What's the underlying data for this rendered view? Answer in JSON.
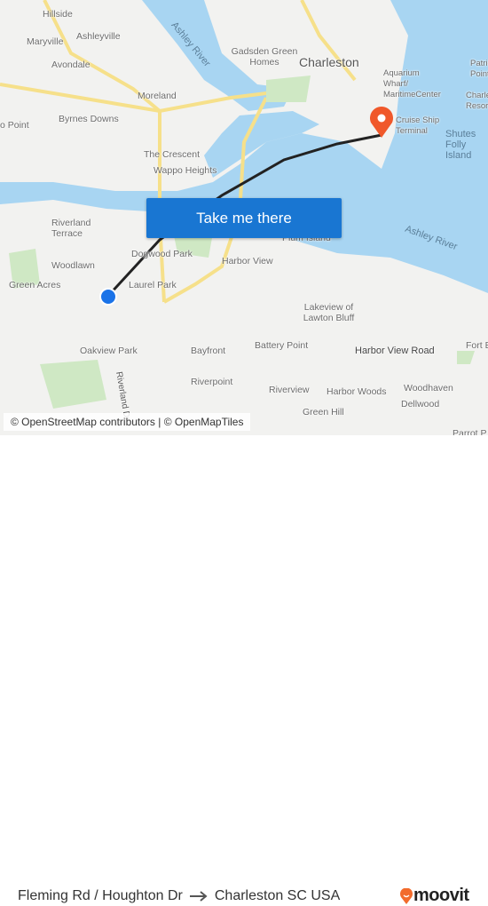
{
  "map": {
    "labels": [
      "Hillside",
      "Ashleyville",
      "Maryville",
      "Avondale",
      "Ashley River",
      "Gadsden Green Homes",
      "Charleston",
      "Aquarium Wharf/ MaritimeCenter",
      "Patriots Point",
      "Moreland",
      "Byrnes Downs",
      "o Point",
      "Charleston Resort",
      "Cruise Ship Terminal",
      "Shutes Folly Island",
      "The Crescent",
      "Wappo Heights",
      "Riverland Terrace",
      "Plum Island",
      "Ashley River",
      "Dogwood Park",
      "Harbor View",
      "Woodlawn",
      "Green Acres",
      "Laurel Park",
      "Lakeview of Lawton Bluff",
      "Battery Point",
      "Harbor View Road",
      "Fort Es",
      "Oakview Park",
      "Bayfront",
      "Riverpoint",
      "Riverland Dr",
      "Riverview",
      "Harbor Woods",
      "Woodhaven",
      "Dellwood",
      "Green Hill",
      "Parrot P"
    ],
    "attribution": "© OpenStreetMap contributors | © OpenMapTiles",
    "water_color": "#a8d5f2",
    "route_color": "#222222",
    "origin_marker_color": "#1a73e8",
    "destination_marker_color": "#f0582a"
  },
  "cta": {
    "label": "Take me there"
  },
  "footer": {
    "origin": "Fleming Rd / Houghton Dr",
    "arrow_icon": "arrow-right-icon",
    "destination": "Charleston SC USA",
    "brand": "moovit",
    "brand_color": "#f26b2c"
  }
}
